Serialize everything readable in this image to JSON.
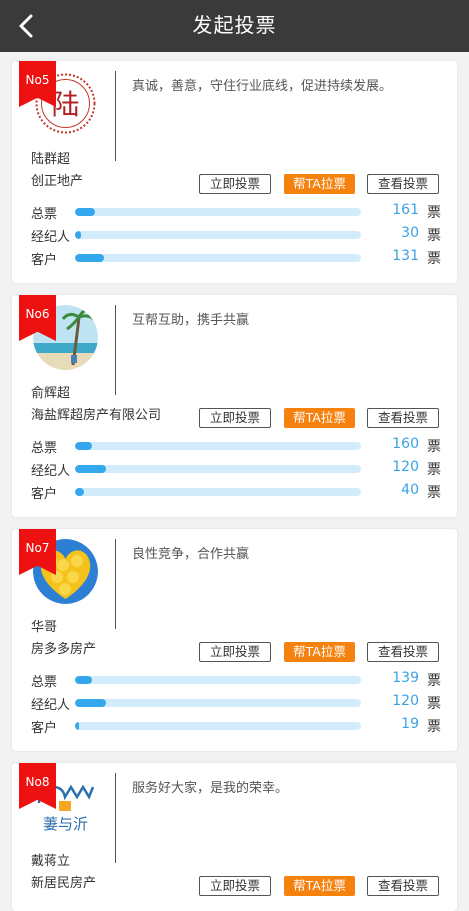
{
  "header": {
    "title": "发起投票"
  },
  "buttons": {
    "vote": "立即投票",
    "help": "帮TA拉票",
    "view": "查看投票"
  },
  "stat_labels": {
    "total": "总票",
    "agent": "经纪人",
    "client": "客户"
  },
  "unit": "票",
  "candidates": [
    {
      "rank": "No5",
      "name": "陆群超",
      "company": "创正地产",
      "motto": "真诚，善意，守住行业底线，促进持续发展。",
      "avatar_text": "陆",
      "stats": {
        "total": 161,
        "agent": 30,
        "client": 131
      },
      "bar_levels": {
        "total": 0.07,
        "agent": 0.02,
        "client": 0.1
      }
    },
    {
      "rank": "No6",
      "name": "俞辉超",
      "company": "海盐辉超房产有限公司",
      "motto": "互帮互助，携手共赢",
      "stats": {
        "total": 160,
        "agent": 120,
        "client": 40
      },
      "bar_levels": {
        "total": 0.06,
        "agent": 0.11,
        "client": 0.03
      }
    },
    {
      "rank": "No7",
      "name": "华哥",
      "company": "房多多房产",
      "motto": "良性竞争，合作共赢",
      "stats": {
        "total": 139,
        "agent": 120,
        "client": 19
      },
      "bar_levels": {
        "total": 0.06,
        "agent": 0.11,
        "client": 0.01
      }
    },
    {
      "rank": "No8",
      "name": "戴蒋立",
      "company": "新居民房产",
      "motto": "服务好大家，是我的荣幸。",
      "avatar_text": "萋与沂"
    }
  ]
}
